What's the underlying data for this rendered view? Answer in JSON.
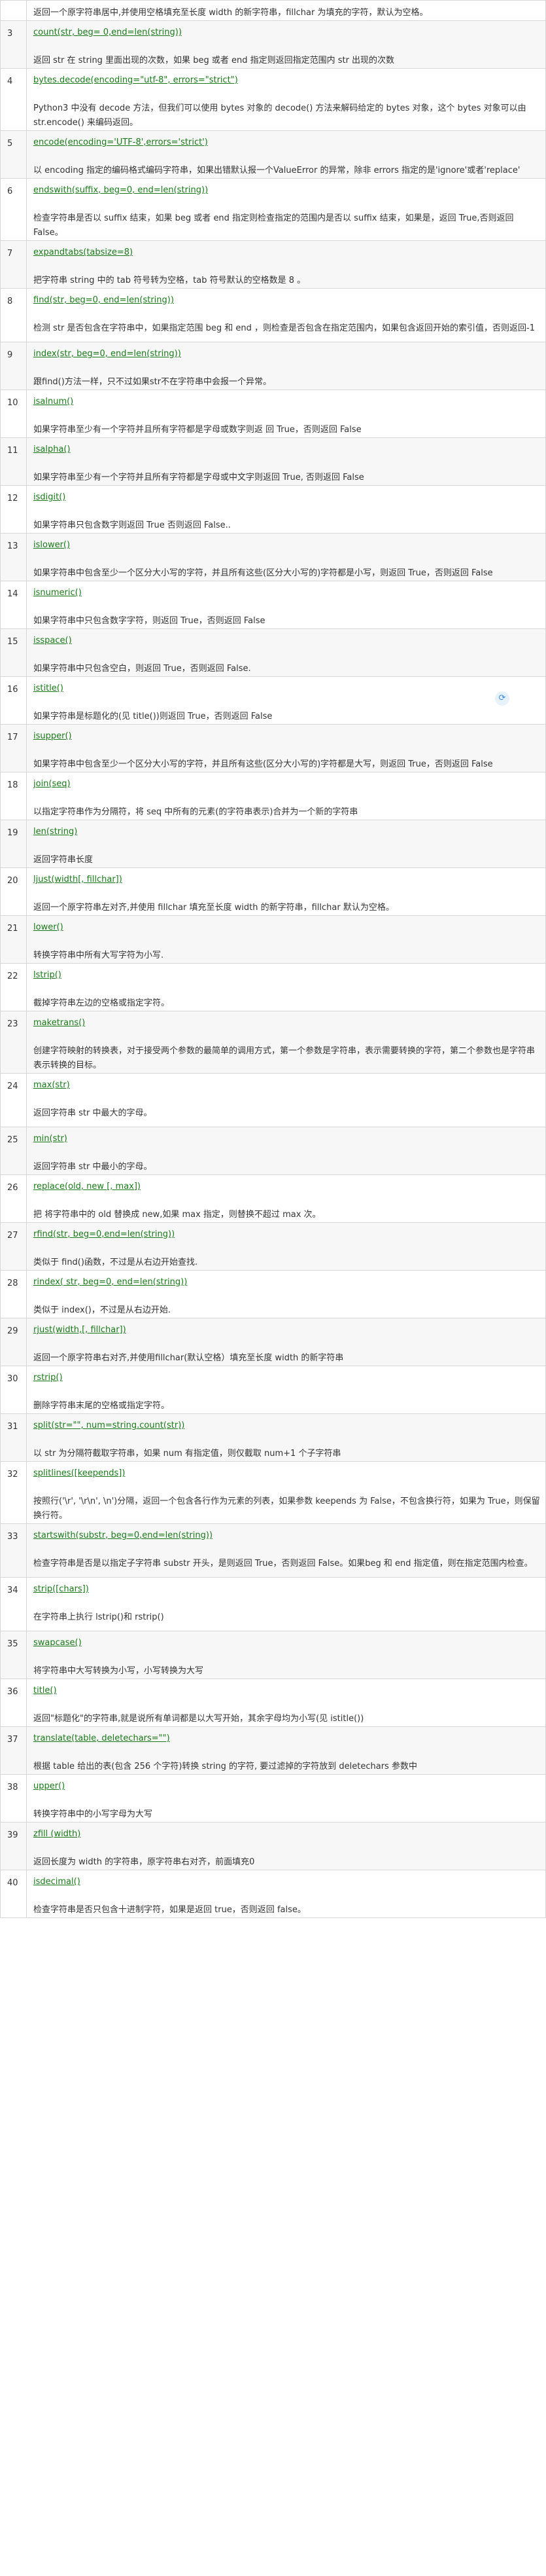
{
  "rows": [
    {
      "num": "",
      "method": "",
      "desc": "返回一个原字符串居中,并使用空格填充至长度 width 的新字符串，fillchar 为填充的字符，默认为空格。"
    },
    {
      "num": "3",
      "method": "count(str, beg= 0,end=len(string))",
      "desc": "返回 str 在 string 里面出现的次数，如果 beg 或者 end 指定则返回指定范围内 str 出现的次数"
    },
    {
      "num": "4",
      "method": "bytes.decode(encoding=\"utf-8\", errors=\"strict\")",
      "desc": "Python3 中没有 decode 方法，但我们可以使用 bytes 对象的 decode() 方法来解码给定的 bytes 对象，这个 bytes 对象可以由 str.encode() 来编码返回。"
    },
    {
      "num": "5",
      "method": "encode(encoding='UTF-8',errors='strict')",
      "desc": "以 encoding 指定的编码格式编码字符串，如果出错默认报一个ValueError 的异常，除非 errors 指定的是'ignore'或者'replace'"
    },
    {
      "num": "6",
      "method": "endswith(suffix, beg=0, end=len(string))",
      "desc": "检查字符串是否以 suffix 结束，如果 beg 或者 end 指定则检查指定的范围内是否以 suffix 结束，如果是，返回 True,否则返回 False。"
    },
    {
      "num": "7",
      "method": "expandtabs(tabsize=8)",
      "desc": "把字符串 string 中的 tab 符号转为空格，tab 符号默认的空格数是 8 。"
    },
    {
      "num": "8",
      "method": "find(str, beg=0, end=len(string))",
      "desc": "检测 str 是否包含在字符串中，如果指定范围 beg 和 end ，则检查是否包含在指定范围内，如果包含返回开始的索引值，否则返回-1"
    },
    {
      "num": "9",
      "method": "index(str, beg=0, end=len(string))",
      "desc": "跟find()方法一样，只不过如果str不在字符串中会报一个异常。"
    },
    {
      "num": "10",
      "method": "isalnum()",
      "desc": "如果字符串至少有一个字符并且所有字符都是字母或数字则返 回 True，否则返回 False"
    },
    {
      "num": "11",
      "method": "isalpha()",
      "desc": "如果字符串至少有一个字符并且所有字符都是字母或中文字则返回 True, 否则返回 False"
    },
    {
      "num": "12",
      "method": "isdigit()",
      "desc": "如果字符串只包含数字则返回 True 否则返回 False.."
    },
    {
      "num": "13",
      "method": "islower()",
      "desc": "如果字符串中包含至少一个区分大小写的字符，并且所有这些(区分大小写的)字符都是小写，则返回 True，否则返回 False"
    },
    {
      "num": "14",
      "method": "isnumeric()",
      "desc": "如果字符串中只包含数字字符，则返回 True，否则返回 False"
    },
    {
      "num": "15",
      "method": "isspace()",
      "desc": "如果字符串中只包含空白，则返回 True，否则返回 False."
    },
    {
      "num": "16",
      "method": "istitle()",
      "desc": "如果字符串是标题化的(见 title())则返回 True，否则返回 False"
    },
    {
      "num": "17",
      "method": "isupper()",
      "desc": "如果字符串中包含至少一个区分大小写的字符，并且所有这些(区分大小写的)字符都是大写，则返回 True，否则返回 False"
    },
    {
      "num": "18",
      "method": "join(seq)",
      "desc": "以指定字符串作为分隔符，将 seq 中所有的元素(的字符串表示)合并为一个新的字符串"
    },
    {
      "num": "19",
      "method": "len(string)",
      "desc": "返回字符串长度"
    },
    {
      "num": "20",
      "method": "ljust(width[, fillchar])",
      "desc": "返回一个原字符串左对齐,并使用 fillchar 填充至长度 width 的新字符串，fillchar 默认为空格。"
    },
    {
      "num": "21",
      "method": "lower()",
      "desc": "转换字符串中所有大写字符为小写."
    },
    {
      "num": "22",
      "method": "lstrip()",
      "desc": "截掉字符串左边的空格或指定字符。"
    },
    {
      "num": "23",
      "method": "maketrans()",
      "desc": "创建字符映射的转换表，对于接受两个参数的最简单的调用方式，第一个参数是字符串，表示需要转换的字符，第二个参数也是字符串表示转换的目标。"
    },
    {
      "num": "24",
      "method": "max(str)",
      "desc": "返回字符串 str 中最大的字母。"
    },
    {
      "num": "25",
      "method": "min(str)",
      "desc": "返回字符串 str 中最小的字母。"
    },
    {
      "num": "26",
      "method": "replace(old, new [, max])",
      "desc": "把 将字符串中的 old 替换成 new,如果 max 指定，则替换不超过 max 次。"
    },
    {
      "num": "27",
      "method": "rfind(str, beg=0,end=len(string))",
      "desc": "类似于 find()函数，不过是从右边开始查找."
    },
    {
      "num": "28",
      "method": "rindex( str, beg=0, end=len(string))",
      "desc": "类似于 index()，不过是从右边开始."
    },
    {
      "num": "29",
      "method": "rjust(width,[, fillchar])",
      "desc": "返回一个原字符串右对齐,并使用fillchar(默认空格）填充至长度 width 的新字符串"
    },
    {
      "num": "30",
      "method": "rstrip()",
      "desc": "删除字符串末尾的空格或指定字符。"
    },
    {
      "num": "31",
      "method": "split(str=\"\", num=string.count(str))",
      "desc": "以 str 为分隔符截取字符串，如果 num 有指定值，则仅截取 num+1 个子字符串"
    },
    {
      "num": "32",
      "method": "splitlines([keepends])",
      "desc": "按照行('\\r', '\\r\\n', \\n')分隔，返回一个包含各行作为元素的列表，如果参数 keepends 为 False，不包含换行符，如果为 True，则保留换行符。"
    },
    {
      "num": "33",
      "method": "startswith(substr, beg=0,end=len(string))",
      "desc": "检查字符串是否是以指定子字符串 substr 开头，是则返回 True，否则返回 False。如果beg 和 end 指定值，则在指定范围内检查。"
    },
    {
      "num": "34",
      "method": "strip([chars])",
      "desc": "在字符串上执行 lstrip()和 rstrip()"
    },
    {
      "num": "35",
      "method": "swapcase()",
      "desc": "将字符串中大写转换为小写，小写转换为大写"
    },
    {
      "num": "36",
      "method": "title()",
      "desc": "返回\"标题化\"的字符串,就是说所有单词都是以大写开始，其余字母均为小写(见 istitle())"
    },
    {
      "num": "37",
      "method": "translate(table, deletechars=\"\")",
      "desc": "根据 table 给出的表(包含 256 个字符)转换 string 的字符, 要过滤掉的字符放到 deletechars 参数中"
    },
    {
      "num": "38",
      "method": "upper()",
      "desc": "转换字符串中的小写字母为大写"
    },
    {
      "num": "39",
      "method": "zfill (width)",
      "desc": "返回长度为 width 的字符串，原字符串右对齐，前面填充0"
    },
    {
      "num": "40",
      "method": "isdecimal()",
      "desc": "检查字符串是否只包含十进制字符，如果是返回 true，否则返回 false。"
    }
  ],
  "float_icon": {
    "name": "refresh-icon",
    "glyph": "⟳"
  }
}
